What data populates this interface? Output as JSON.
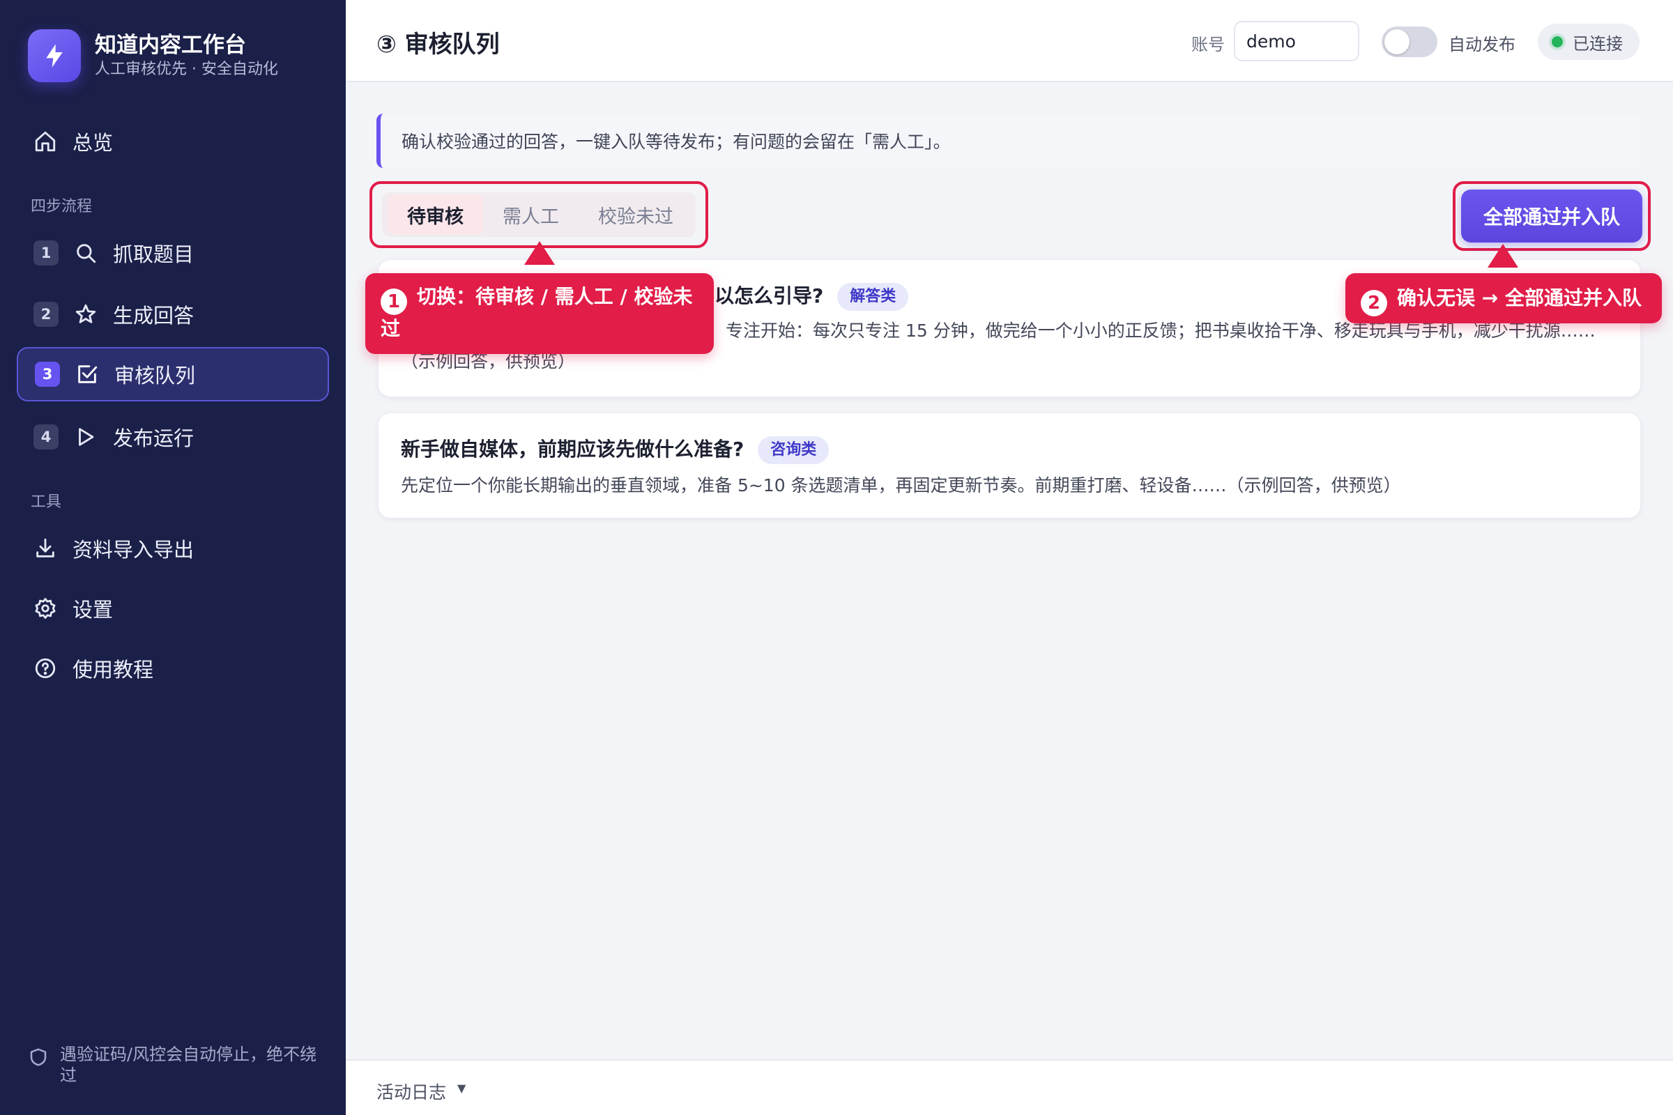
{
  "brand": {
    "title": "知道内容工作台",
    "subtitle": "人工审核优先 · 安全自动化"
  },
  "sidebar": {
    "overview": "总览",
    "section_steps": "四步流程",
    "steps": [
      {
        "num": "1",
        "label": "抓取题目",
        "icon": "search-icon"
      },
      {
        "num": "2",
        "label": "生成回答",
        "icon": "star-icon"
      },
      {
        "num": "3",
        "label": "审核队列",
        "icon": "checkbox-icon"
      },
      {
        "num": "4",
        "label": "发布运行",
        "icon": "play-icon"
      }
    ],
    "section_tools": "工具",
    "tools": [
      {
        "label": "资料导入导出",
        "icon": "download-icon"
      },
      {
        "label": "设置",
        "icon": "gear-icon"
      },
      {
        "label": "使用教程",
        "icon": "help-icon"
      }
    ],
    "footer_note": "遇验证码/风控会自动停止，绝不绕过"
  },
  "header": {
    "title": "③ 审核队列",
    "account_label": "账号",
    "account_value": "demo",
    "auto_publish_label": "自动发布",
    "status": "已连接"
  },
  "main": {
    "notice": "确认校验通过的回答，一键入队等待发布；有问题的会留在「需人工」。",
    "tabs": [
      "待审核",
      "需人工",
      "校验未过"
    ],
    "primary_action": "全部通过并入队",
    "cards": [
      {
        "question": "以怎么引导?",
        "tag": "解答类",
        "answer": "专注开始：每次只专注 15 分钟，做完给一个小小的正反馈；把书桌收拾干净、移走玩具与手机，减少干扰源……（示例回答，供预览）"
      },
      {
        "question": "新手做自媒体，前期应该先做什么准备?",
        "tag": "咨询类",
        "answer": "先定位一个你能长期输出的垂直领域，准备 5~10 条选题清单，再固定更新节奏。前期重打磨、轻设备……（示例回答，供预览）"
      }
    ]
  },
  "callouts": [
    {
      "num": "1",
      "text": "切换：待审核 / 需人工 / 校验未过"
    },
    {
      "num": "2",
      "text": "确认无误 → 全部通过并入队"
    }
  ],
  "footer": {
    "activity_log": "活动日志"
  },
  "colors": {
    "sidebar_bg": "#1b2049",
    "accent": "#6653f0",
    "callout": "#e11d48",
    "status_ok": "#22b45a"
  }
}
